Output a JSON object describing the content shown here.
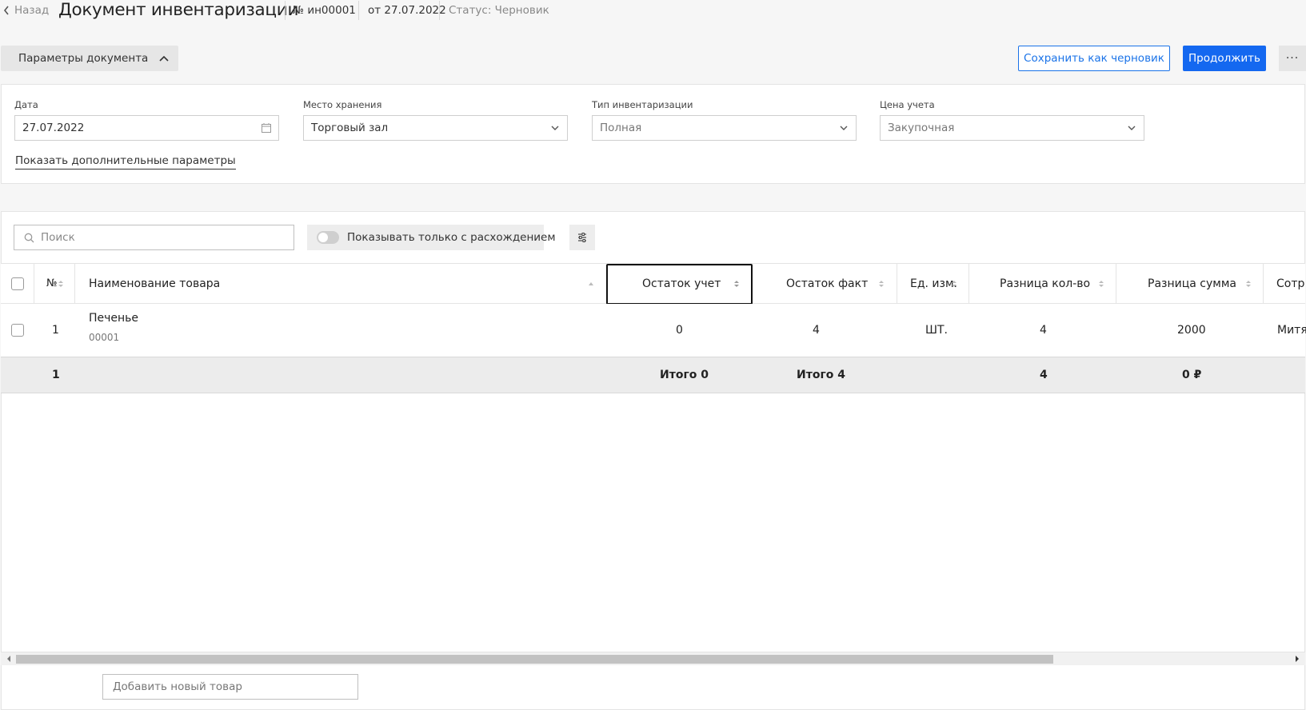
{
  "header": {
    "back_label": "Назад",
    "title": "Документ инвентаризации",
    "number": "№ ин00001",
    "date": "от 27.07.2022",
    "status": "Статус: Черновик"
  },
  "toolbar": {
    "params_label": "Параметры документа",
    "save_draft_label": "Сохранить как черновик",
    "continue_label": "Продолжить",
    "more_label": "···"
  },
  "params": {
    "date": {
      "label": "Дата",
      "value": "27.07.2022"
    },
    "storage": {
      "label": "Место хранения",
      "value": "Торговый зал"
    },
    "inventory_type": {
      "label": "Тип инвентаризации",
      "value": "Полная"
    },
    "price": {
      "label": "Цена учета",
      "value": "Закупочная"
    },
    "more_link": "Показать дополнительные параметры"
  },
  "table_tools": {
    "search_placeholder": "Поиск",
    "toggle_label": "Показывать только с расхождением"
  },
  "table": {
    "headers": {
      "num": "№",
      "name": "Наименование товара",
      "stock_acc": "Остаток учет",
      "stock_fact": "Остаток факт",
      "unit": "Ед. изм.",
      "diff_qty": "Разница кол-во",
      "diff_sum": "Разница сумма",
      "employee": "Сотр"
    },
    "rows": [
      {
        "num": "1",
        "name": "Печенье",
        "code": "00001",
        "stock_acc": "0",
        "stock_fact": "4",
        "unit": "ШТ.",
        "diff_qty": "4",
        "diff_sum": "2000",
        "employee": "Митя"
      }
    ],
    "totals": {
      "count": "1",
      "stock_acc": "Итого 0",
      "stock_fact": "Итого 4",
      "diff_qty": "4",
      "diff_sum": "0 ₽"
    }
  },
  "footer": {
    "add_product": "Добавить новый товар"
  },
  "colors": {
    "primary": "#1468f0",
    "outline": "#1a73e8"
  }
}
